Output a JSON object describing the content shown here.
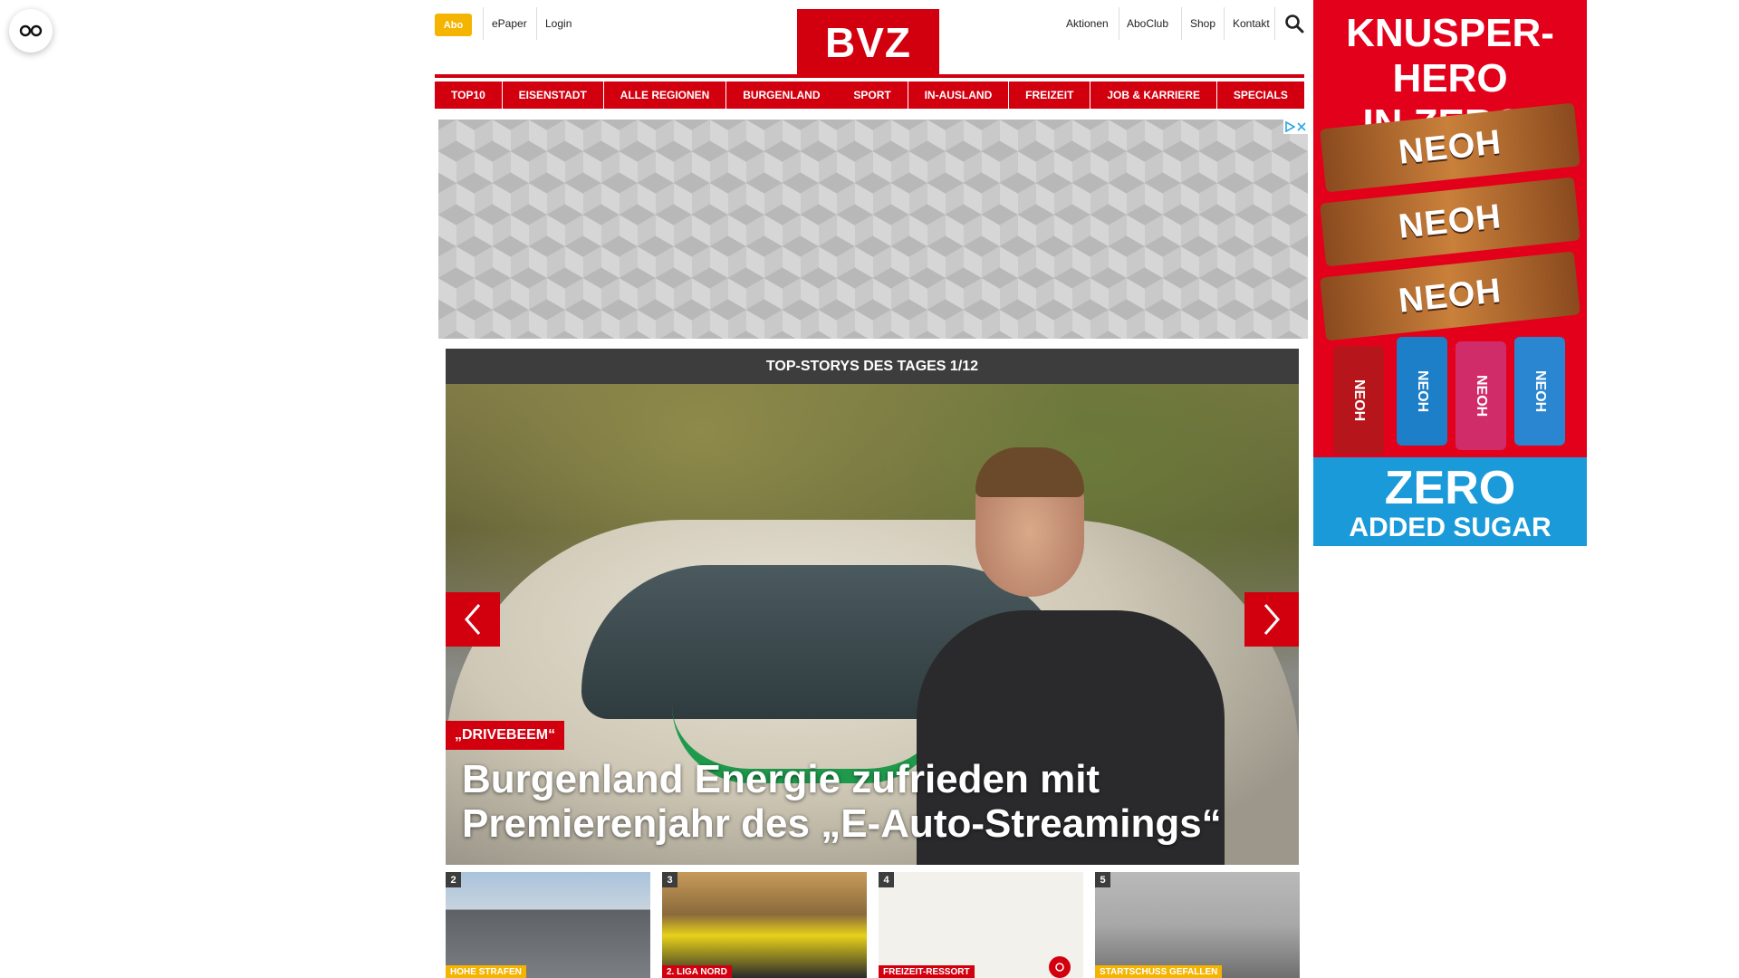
{
  "header": {
    "abo_label": "Abo",
    "links_left": [
      "ePaper",
      "Login"
    ],
    "logo_text": "BVZ",
    "links_right": [
      "Aktionen",
      "AboClub",
      "Shop",
      "Kontakt"
    ]
  },
  "nav": {
    "items": [
      "TOP10",
      "EISENSTADT",
      "ALLE REGIONEN",
      "BURGENLAND",
      "SPORT",
      "IN-AUSLAND",
      "FREIZEIT",
      "JOB & KARRIERE",
      "SPECIALS"
    ]
  },
  "stories": {
    "header": "TOP-STORYS DES TAGES 1/12",
    "hero": {
      "tag": "„DRIVEBEEM“",
      "title": "Burgenland Energie zufrieden mit Premierenjahr des „E-Auto-Streamings“"
    },
    "thumbs": [
      {
        "num": "2",
        "tag": "HOHE STRAFEN"
      },
      {
        "num": "3",
        "tag": "2. LIGA NORD"
      },
      {
        "num": "4",
        "tag": "FREIZEIT-RESSORT"
      },
      {
        "num": "5",
        "tag": "STARTSCHUSS GEFALLEN"
      }
    ]
  },
  "side_ad": {
    "title_line1": "KNUSPER-HERO",
    "title_line2": "IN ZERO!",
    "brand": "NEOH",
    "bottom_line1": "ZERO",
    "bottom_line2": "ADDED SUGAR"
  },
  "colors": {
    "brand_red": "#d2000f",
    "abo_yellow": "#f5b400",
    "story_header_bg": "#3d3d3d"
  }
}
